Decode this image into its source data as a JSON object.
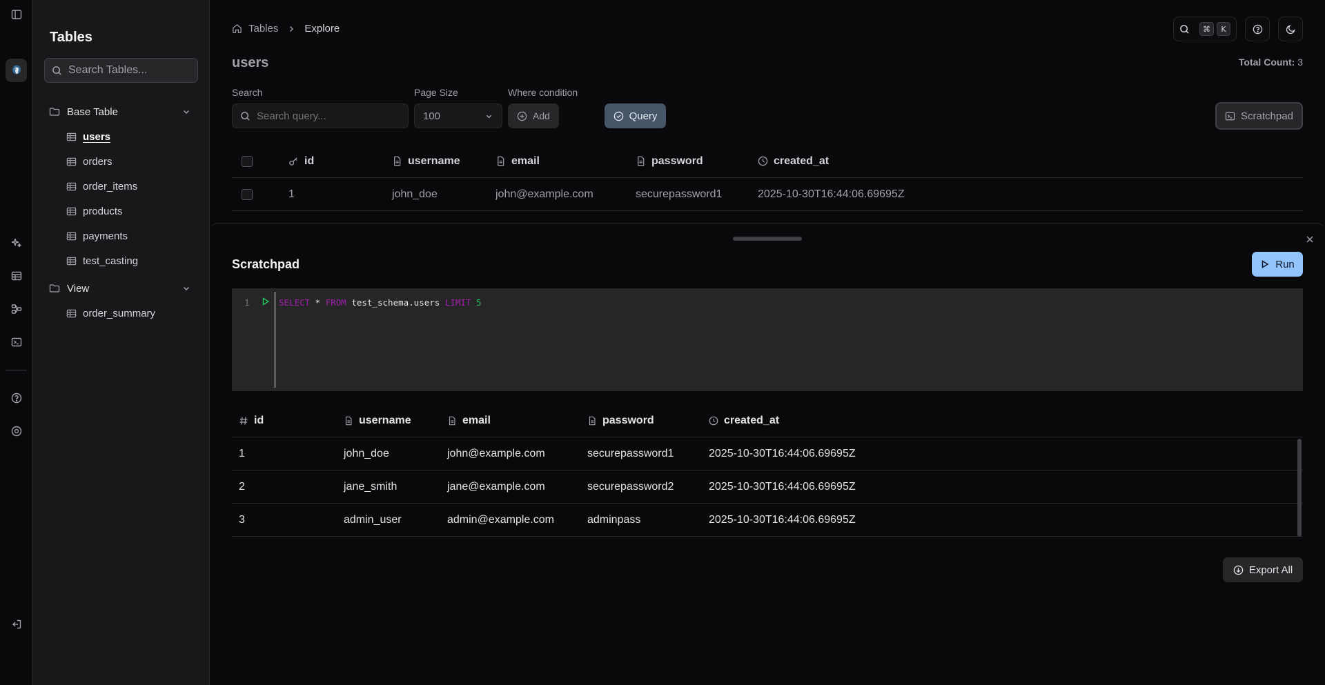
{
  "sidebar": {
    "title": "Tables",
    "search_placeholder": "Search Tables...",
    "groups": [
      {
        "label": "Base Table",
        "items": [
          "users",
          "orders",
          "order_items",
          "products",
          "payments",
          "test_casting"
        ]
      },
      {
        "label": "View",
        "items": [
          "order_summary"
        ]
      }
    ],
    "active_item": "users"
  },
  "breadcrumb": {
    "home": "Tables",
    "current": "Explore"
  },
  "shortcut": {
    "mod": "⌘",
    "key": "K"
  },
  "page": {
    "title": "users",
    "total_label": "Total Count:",
    "total_value": "3"
  },
  "filters": {
    "search_label": "Search",
    "search_placeholder": "Search query...",
    "page_size_label": "Page Size",
    "page_size_value": "100",
    "where_label": "Where condition",
    "add_label": "Add",
    "query_label": "Query",
    "scratchpad_label": "Scratchpad"
  },
  "table": {
    "columns": [
      "id",
      "username",
      "email",
      "password",
      "created_at"
    ],
    "rows": [
      [
        "1",
        "john_doe",
        "john@example.com",
        "securepassword1",
        "2025-10-30T16:44:06.69695Z"
      ]
    ]
  },
  "scratchpad": {
    "title": "Scratchpad",
    "run_label": "Run",
    "line_number": "1",
    "code": {
      "kw1": "SELECT",
      "star": " * ",
      "kw2": "FROM",
      "table": " test_schema.users ",
      "kw3": "LIMIT",
      "sp": " ",
      "num": "5"
    },
    "result_columns": [
      "id",
      "username",
      "email",
      "password",
      "created_at"
    ],
    "result_rows": [
      [
        "1",
        "john_doe",
        "john@example.com",
        "securepassword1",
        "2025-10-30T16:44:06.69695Z"
      ],
      [
        "2",
        "jane_smith",
        "jane@example.com",
        "securepassword2",
        "2025-10-30T16:44:06.69695Z"
      ],
      [
        "3",
        "admin_user",
        "admin@example.com",
        "adminpass",
        "2025-10-30T16:44:06.69695Z"
      ]
    ],
    "export_label": "Export All"
  },
  "colors": {
    "accent_run": "#93c5fd",
    "query_button": "#475569",
    "keyword": "#a21caf",
    "number": "#22c55e"
  }
}
